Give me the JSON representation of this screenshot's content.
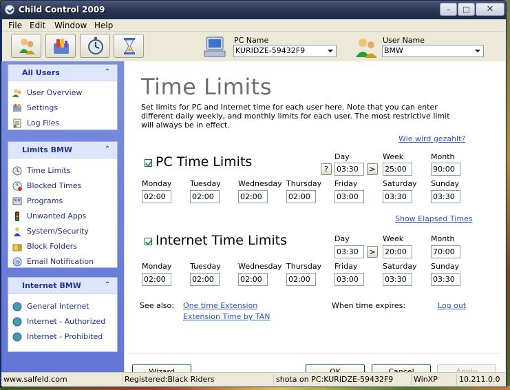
{
  "window": {
    "title": "Child Control 2009"
  },
  "menu": [
    "File",
    "Edit",
    "Window",
    "Help"
  ],
  "toolbar": {
    "pc_name_label": "PC Name",
    "pc_name_value": "KURIDZE-59432F9",
    "user_name_label": "User Name",
    "user_name_value": "BMW"
  },
  "sidebar": {
    "panels": [
      {
        "title": "All Users",
        "items": [
          "User Overview",
          "Settings",
          "Log Files"
        ]
      },
      {
        "title": "Limits BMW",
        "items": [
          "Time Limits",
          "Blocked Times",
          "Programs",
          "Unwanted Apps",
          "System/Security",
          "Block Folders",
          "Email Notification"
        ]
      },
      {
        "title": "Internet BMW",
        "items": [
          "General Internet",
          "Internet - Authorized",
          "Internet - Prohibited"
        ]
      }
    ]
  },
  "main": {
    "title": "Time Limits",
    "description": "Set limits for PC and Internet time for each user here. Note that you can enter different daily weekly, and monthly limits for each user. The most restrictive limit will always be in effect.",
    "help_link": "Wie wird gezahlt?",
    "pc": {
      "title": "PC Time Limits",
      "day_label": "Day",
      "week_label": "Week",
      "month_label": "Month",
      "question_btn": "?",
      "arrow_btn": ">",
      "day": "03:30",
      "week": "25:00",
      "month": "90:00",
      "days": [
        {
          "label": "Monday",
          "value": "02:00"
        },
        {
          "label": "Tuesday",
          "value": "02:00"
        },
        {
          "label": "Wednesday",
          "value": "02:00"
        },
        {
          "label": "Thursday",
          "value": "02:00"
        },
        {
          "label": "Friday",
          "value": "03:00"
        },
        {
          "label": "Saturday",
          "value": "03:30"
        },
        {
          "label": "Sunday",
          "value": "03:30"
        }
      ]
    },
    "elapsed_link": "Show Elapsed Times",
    "internet": {
      "title": "Internet Time Limits",
      "day_label": "Day",
      "week_label": "Week",
      "month_label": "Month",
      "arrow_btn": ">",
      "day": "03:30",
      "week": "20:00",
      "month": "70:00",
      "days": [
        {
          "label": "Monday",
          "value": "02:00"
        },
        {
          "label": "Tuesday",
          "value": "02:00"
        },
        {
          "label": "Wednesday",
          "value": "02:00"
        },
        {
          "label": "Thursday",
          "value": "02:00"
        },
        {
          "label": "Friday",
          "value": "03:00"
        },
        {
          "label": "Saturday",
          "value": "03:30"
        },
        {
          "label": "Sunday",
          "value": "03:30"
        }
      ]
    },
    "see_also_label": "See also:",
    "one_time_extension": "One time Extension",
    "extension_by_tan": "Extension Time by TAN",
    "when_expires_label": "When time expires:",
    "expires_action": "Log out"
  },
  "buttons": {
    "wizard": "Wizard",
    "ok": "OK",
    "cancel": "Cancel",
    "apply": "Apply"
  },
  "status": {
    "website": "www.salfeld.com",
    "registered": "Registered:Black Riders",
    "session": "shota on PC:KURIDZE-59432F9",
    "os": "WinXP",
    "version": "10.211.0.0"
  }
}
